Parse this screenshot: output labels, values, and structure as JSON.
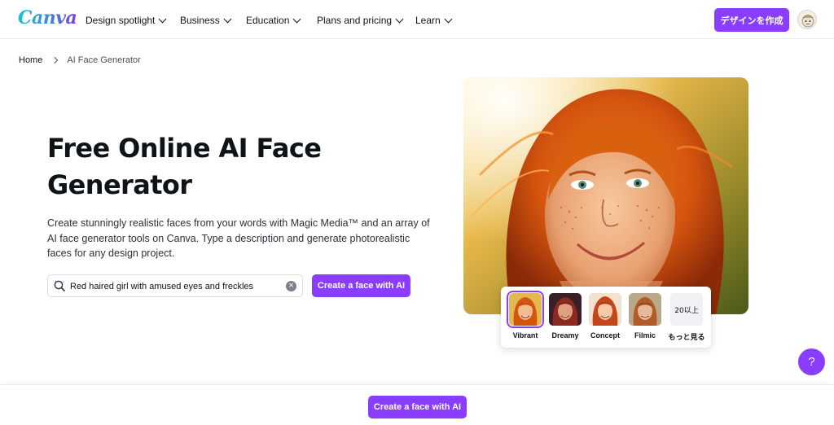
{
  "header": {
    "logo": "Canva",
    "nav": [
      "Design spotlight",
      "Business",
      "Education",
      "Plans and pricing",
      "Learn"
    ],
    "cta_label": "デザインを作成"
  },
  "breadcrumb": {
    "home": "Home",
    "current": "AI Face Generator"
  },
  "hero": {
    "title": "Free Online AI Face Generator",
    "description": "Create stunningly realistic faces from your words with Magic Media™ and an array of AI face generator tools on Canva. Type a description and generate photorealistic faces for any design project.",
    "search": {
      "value": "Red haired girl with amused eyes and freckles"
    },
    "cta_label": "Create a face with AI"
  },
  "styles": {
    "selected": "Vibrant",
    "options": [
      {
        "label": "Vibrant",
        "selected": true
      },
      {
        "label": "Dreamy",
        "selected": false
      },
      {
        "label": "Concept",
        "selected": false
      },
      {
        "label": "Filmic",
        "selected": false
      }
    ],
    "more_count": "20以上",
    "more_label": "もっと見る"
  },
  "help": {
    "label": "?"
  },
  "bottom_bar": {
    "cta_label": "Create a face with AI"
  },
  "colors": {
    "accent": "#8b3dff",
    "text": "#0e1318",
    "logo_gradient": [
      "#17c3c8",
      "#3d8bd9",
      "#7a3bde"
    ]
  },
  "icons": {
    "search": "magic-search-icon",
    "clear": "clear-icon",
    "nav_dropdown": "chevron-down-icon",
    "breadcrumb_separator": "chevron-right-icon"
  }
}
